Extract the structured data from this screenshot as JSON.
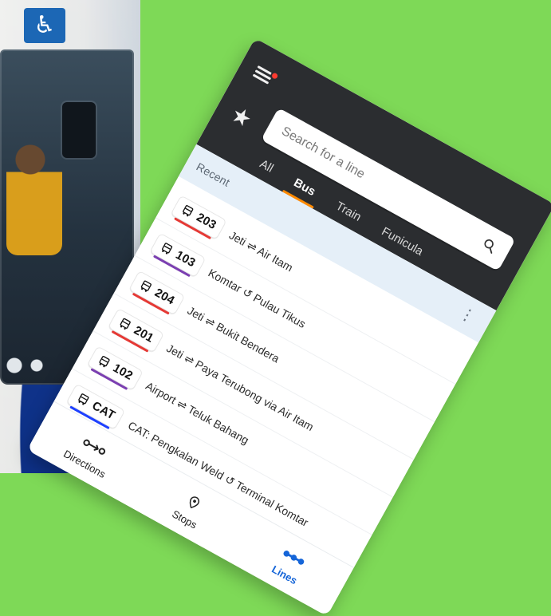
{
  "header": {
    "search": {
      "placeholder": "Search for a line"
    },
    "tabs": [
      {
        "label": "All",
        "active": false
      },
      {
        "label": "Bus",
        "active": true
      },
      {
        "label": "Train",
        "active": false
      },
      {
        "label": "Funicula",
        "active": false
      }
    ]
  },
  "recent": {
    "title": "Recent",
    "items": [
      {
        "code": "203",
        "desc": "Jeti ⇌ Air Itam",
        "line_color": "#e53935"
      },
      {
        "code": "103",
        "desc": "Komtar ↺ Pulau Tikus",
        "line_color": "#7b3fb1"
      },
      {
        "code": "204",
        "desc": "Jeti ⇌ Bukit Bendera",
        "line_color": "#e53935"
      },
      {
        "code": "201",
        "desc": "Jeti ⇌ Paya Terubong via Air Itam",
        "line_color": "#e53935"
      },
      {
        "code": "102",
        "desc": "Airport ⇌ Teluk Bahang",
        "line_color": "#7b3fb1"
      },
      {
        "code": "CAT",
        "desc": "CAT: Pengkalan Weld ↺ Terminal Komtar",
        "line_color": "#1e40ff"
      }
    ]
  },
  "bottom_nav": {
    "items": [
      {
        "label": "Directions",
        "active": false,
        "icon": "route-icon"
      },
      {
        "label": "Stops",
        "active": false,
        "icon": "location-pin-icon"
      },
      {
        "label": "Lines",
        "active": true,
        "icon": "lines-dots-icon"
      }
    ]
  },
  "colors": {
    "topbar": "#2b2d30",
    "accent_orange": "#ff8a00",
    "lines_blue": "#1565d8",
    "background_green": "#7ed957"
  }
}
